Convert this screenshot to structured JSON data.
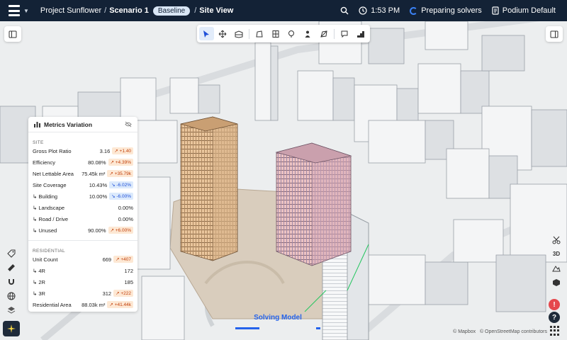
{
  "header": {
    "project": "Project Sunflower",
    "scenario": "Scenario 1",
    "badge": "Baseline",
    "view": "Site View",
    "time": "1:53 PM",
    "status": "Preparing solvers",
    "podium": "Podium Default"
  },
  "toolbar": {
    "tools": [
      "select-icon",
      "move-icon",
      "building-icon",
      "plot-icon",
      "floor-icon",
      "tree-icon",
      "person-icon",
      "measure-icon",
      "comment-icon",
      "steps-icon"
    ]
  },
  "metrics": {
    "title": "Metrics Variation",
    "site_label": "SITE",
    "site_rows": [
      {
        "label": "Gross Plot Ratio",
        "value": "3.16",
        "delta": "+1.40",
        "dir": "up"
      },
      {
        "label": "Efficiency",
        "value": "80.08%",
        "delta": "+4.39%",
        "dir": "up"
      },
      {
        "label": "Net Lettable Area",
        "value": "75.45k m²",
        "delta": "+35.79k",
        "dir": "up"
      },
      {
        "label": "Site Coverage",
        "value": "10.43%",
        "delta": "-6.02%",
        "dir": "down"
      },
      {
        "label": "↳ Building",
        "value": "10.00%",
        "delta": "-6.00%",
        "dir": "down"
      },
      {
        "label": "↳ Landscape",
        "value": "0.00%",
        "delta": "",
        "dir": ""
      },
      {
        "label": "↳ Road / Drive",
        "value": "0.00%",
        "delta": "",
        "dir": ""
      },
      {
        "label": "↳ Unused",
        "value": "90.00%",
        "delta": "+6.00%",
        "dir": "up"
      }
    ],
    "res_label": "RESIDENTIAL",
    "res_rows": [
      {
        "label": "Unit Count",
        "value": "669",
        "delta": "+407",
        "dir": "up"
      },
      {
        "label": "↳ 4R",
        "value": "172",
        "delta": "",
        "dir": ""
      },
      {
        "label": "↳ 2R",
        "value": "185",
        "delta": "",
        "dir": ""
      },
      {
        "label": "↳ 3R",
        "value": "312",
        "delta": "+222",
        "dir": "up"
      },
      {
        "label": "Residential Area",
        "value": "88.03k m²",
        "delta": "+41.44k",
        "dir": "up"
      }
    ]
  },
  "right_tools": {
    "three_d": "3D"
  },
  "solving": {
    "label": "Solving Model",
    "progress": 0.7
  },
  "attribution": {
    "mapbox": "© Mapbox",
    "osm": "© OpenStreetMap contributors"
  },
  "alert": {
    "label": "!"
  },
  "help": {
    "label": "?"
  }
}
